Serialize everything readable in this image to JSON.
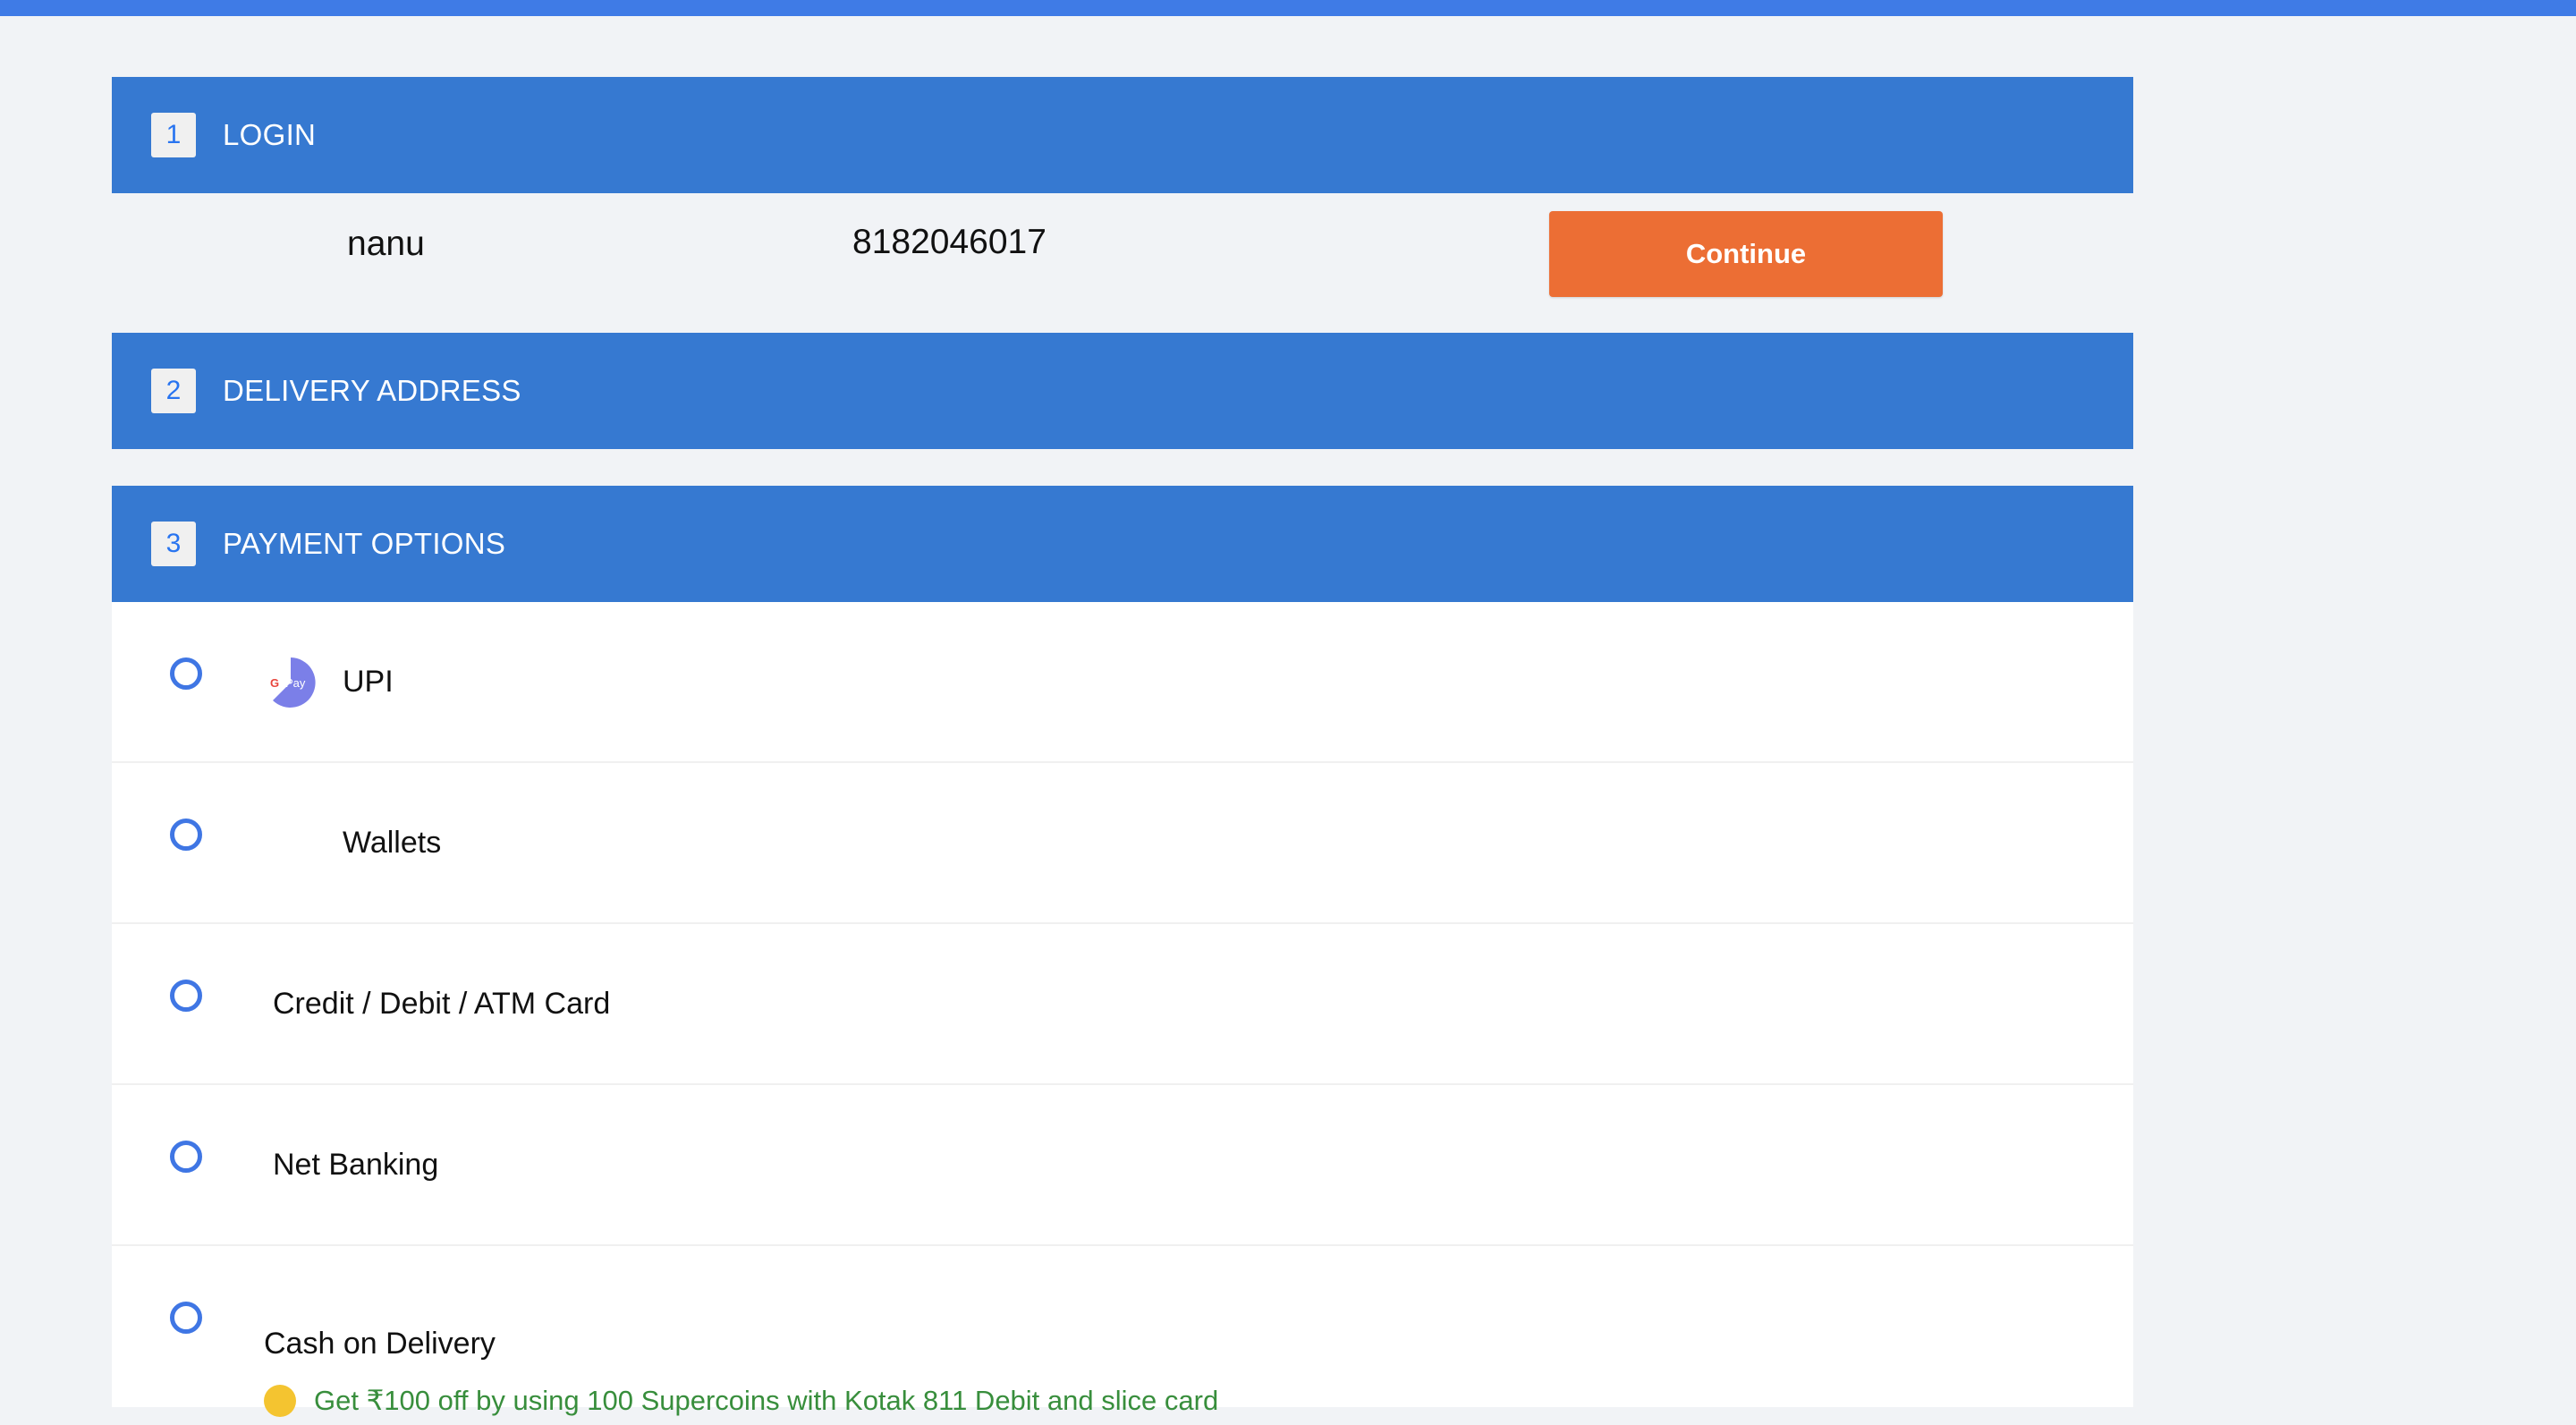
{
  "login": {
    "step": "1",
    "title": "LOGIN",
    "name": "nanu",
    "phone": "8182046017",
    "continue_label": "Continue"
  },
  "delivery": {
    "step": "2",
    "title": "DELIVERY ADDRESS"
  },
  "payment": {
    "step": "3",
    "title": "PAYMENT OPTIONS",
    "options": [
      {
        "label": "UPI",
        "icon": "gpay-icon"
      },
      {
        "label": "Wallets"
      },
      {
        "label": "Credit / Debit / ATM Card"
      },
      {
        "label": "Net Banking"
      },
      {
        "label": "Cash on Delivery",
        "offer": "Get ₹100 off by using 100 Supercoins with Kotak 811 Debit and slice card"
      }
    ],
    "gpay_text": "Pay"
  },
  "colors": {
    "header_blue": "#3679d1",
    "accent_orange": "#ec6e34",
    "radio_blue": "#3f76e4",
    "offer_green": "#388e3c"
  }
}
